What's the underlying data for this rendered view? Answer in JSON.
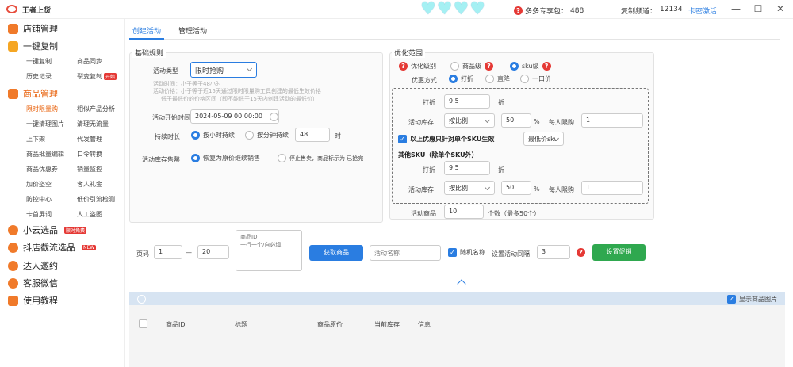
{
  "window": {
    "title": "王者上货",
    "package": "多多专享包：",
    "package_count": "488",
    "copy_freq_label": "复制频道：",
    "copy_freq_value": "12134",
    "card_link": "卡密激活",
    "minimize": "—",
    "maximize": "☐",
    "close": "✕"
  },
  "sidebar": {
    "store_mgmt": "店铺管理",
    "one_click_copy": "一键复制",
    "copy_items": [
      "一键复制",
      "商品同步",
      "历史记录",
      "裂变复制"
    ],
    "copy_badge": "开始",
    "product_mgmt": "商品管理",
    "product_items": [
      "限时限量购",
      "相似产品分析",
      "一键清理图片",
      "清理无流量",
      "上下架",
      "代发管理",
      "商品批量编辑",
      "口令转换",
      "商品优惠券",
      "销量监控",
      "加价盗空",
      "客人礼金",
      "防控中心",
      "低价引流检测",
      "卡首屏词",
      "人工盗图"
    ],
    "cloud_select": "小云选品",
    "cloud_badge": "限时免费",
    "shop_select": "抖店截流选品",
    "shop_badge": "NEW",
    "influencer": "达人邀约",
    "wechat": "客服微信",
    "tutorial": "使用教程"
  },
  "tabs": [
    "创建活动",
    "管理活动"
  ],
  "basic": {
    "title": "基础规则",
    "type_label": "活动类型",
    "type_value": "限时抢购",
    "hint1": "活动时间：小于等于48小时",
    "hint2": "活动价格：小于等于近15天通过限时限量购工具创建的最低生效价格",
    "hint3": "低于最低价的价格区间（即不能低于15天内创建活动的最低价）",
    "start_label": "活动开始时间",
    "start_value": "2024-05-09 00:00:00",
    "duration_label": "持续时长",
    "dur_hour": "按小时持续",
    "dur_min": "按分钟持续",
    "dur_value": "48",
    "dur_unit": "时",
    "stock_label": "活动库存售罄",
    "stock_opt1": "恢复为原价继续销售",
    "stock_opt2": "停止售卖，商品标示为 已抢完"
  },
  "opt": {
    "title": "优化范围",
    "level_label": "优化级别",
    "level_product": "商品级",
    "level_sku": "sku级",
    "method_label": "优惠方式",
    "m_discount": "打折",
    "m_direct": "直降",
    "m_price": "一口价",
    "discount_label": "打折",
    "discount_value": "9.5",
    "discount_unit": "折",
    "stock_label": "活动库存",
    "stock_mode": "按比例",
    "stock_pct": "50",
    "pct": "%",
    "limit_label": "每人限购",
    "limit_value": "1",
    "only_sku": "以上优惠只针对单个SKU生效",
    "sku_mode": "最低价sku",
    "other_sku": "其他SKU（除单个SKU外）",
    "discount2": "9.5",
    "stock_mode2": "按比例",
    "stock_pct2": "50",
    "limit2": "1",
    "goods_label": "活动商品",
    "goods_value": "10",
    "goods_hint": "个数（最多50个）"
  },
  "bottom": {
    "page_label": "页码",
    "page_from": "1",
    "dash": "—",
    "page_to": "20",
    "ids_placeholder": "商品ID\n一行一个/自必填",
    "get_btn": "获取商品",
    "name_placeholder": "活动名称",
    "random_name": "随机名称",
    "interval_label": "设置活动间隔",
    "interval_value": "3",
    "settle_btn": "设置促销",
    "show_img": "显示商品图片"
  },
  "table": {
    "cols": [
      "商品ID",
      "标题",
      "商品原价",
      "当前库存",
      "信息"
    ]
  },
  "colors": {
    "accent": "#2a7de1",
    "orange": "#e8600a",
    "green": "#2fa84f",
    "red": "#e53935"
  }
}
